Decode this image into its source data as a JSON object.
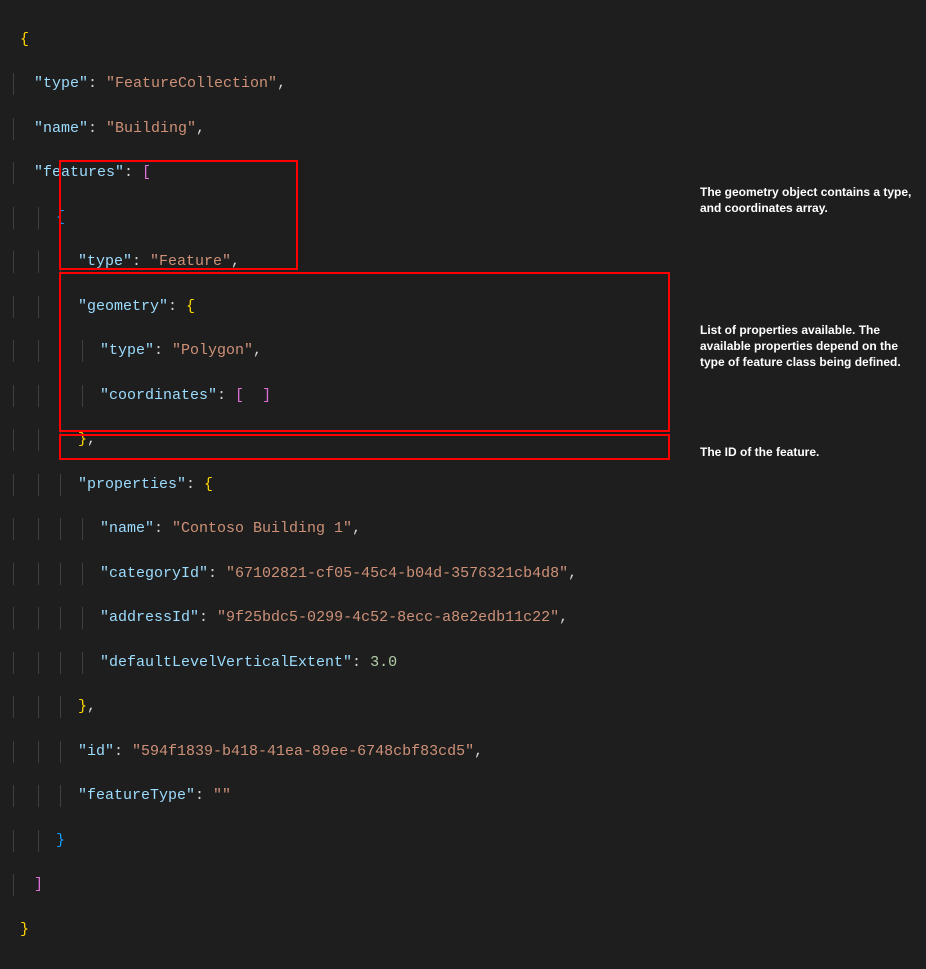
{
  "code": {
    "l1": "{",
    "l2_type_key": "\"type\"",
    "l2_type_val": "\"FeatureCollection\"",
    "l3_name_key": "\"name\"",
    "l3_name_val": "\"Building\"",
    "l4_features_key": "\"features\"",
    "l5_brace": "{",
    "l6_type_key": "\"type\"",
    "l6_type_val": "\"Feature\"",
    "l7_geometry_key": "\"geometry\"",
    "l8_type_key": "\"type\"",
    "l8_type_val": "\"Polygon\"",
    "l9_coords_key": "\"coordinates\"",
    "l10_close": "},",
    "l11_properties_key": "\"properties\"",
    "l12_name_key": "\"name\"",
    "l12_name_val": "\"Contoso Building 1\"",
    "l13_catid_key": "\"categoryId\"",
    "l13_catid_val": "\"67102821-cf05-45c4-b04d-3576321cb4d8\"",
    "l14_addrid_key": "\"addressId\"",
    "l14_addrid_val": "\"9f25bdc5-0299-4c52-8ecc-a8e2edb11c22\"",
    "l15_dlve_key": "\"defaultLevelVerticalExtent\"",
    "l15_dlve_val": "3.0",
    "l16_close": "},",
    "l17_id_key": "\"id\"",
    "l17_id_val": "\"594f1839-b418-41ea-89ee-6748cbf83cd5\"",
    "l18_ft_key": "\"featureType\"",
    "l18_ft_val": "\"\"",
    "l19_close": "}",
    "l20_close": "]",
    "l21_close": "}"
  },
  "annotations": {
    "a1": "The geometry object contains a type, and coordinates array.",
    "a2": "List of properties available. The available properties depend on the type of feature class being defined.",
    "a3": "The ID of the feature."
  }
}
